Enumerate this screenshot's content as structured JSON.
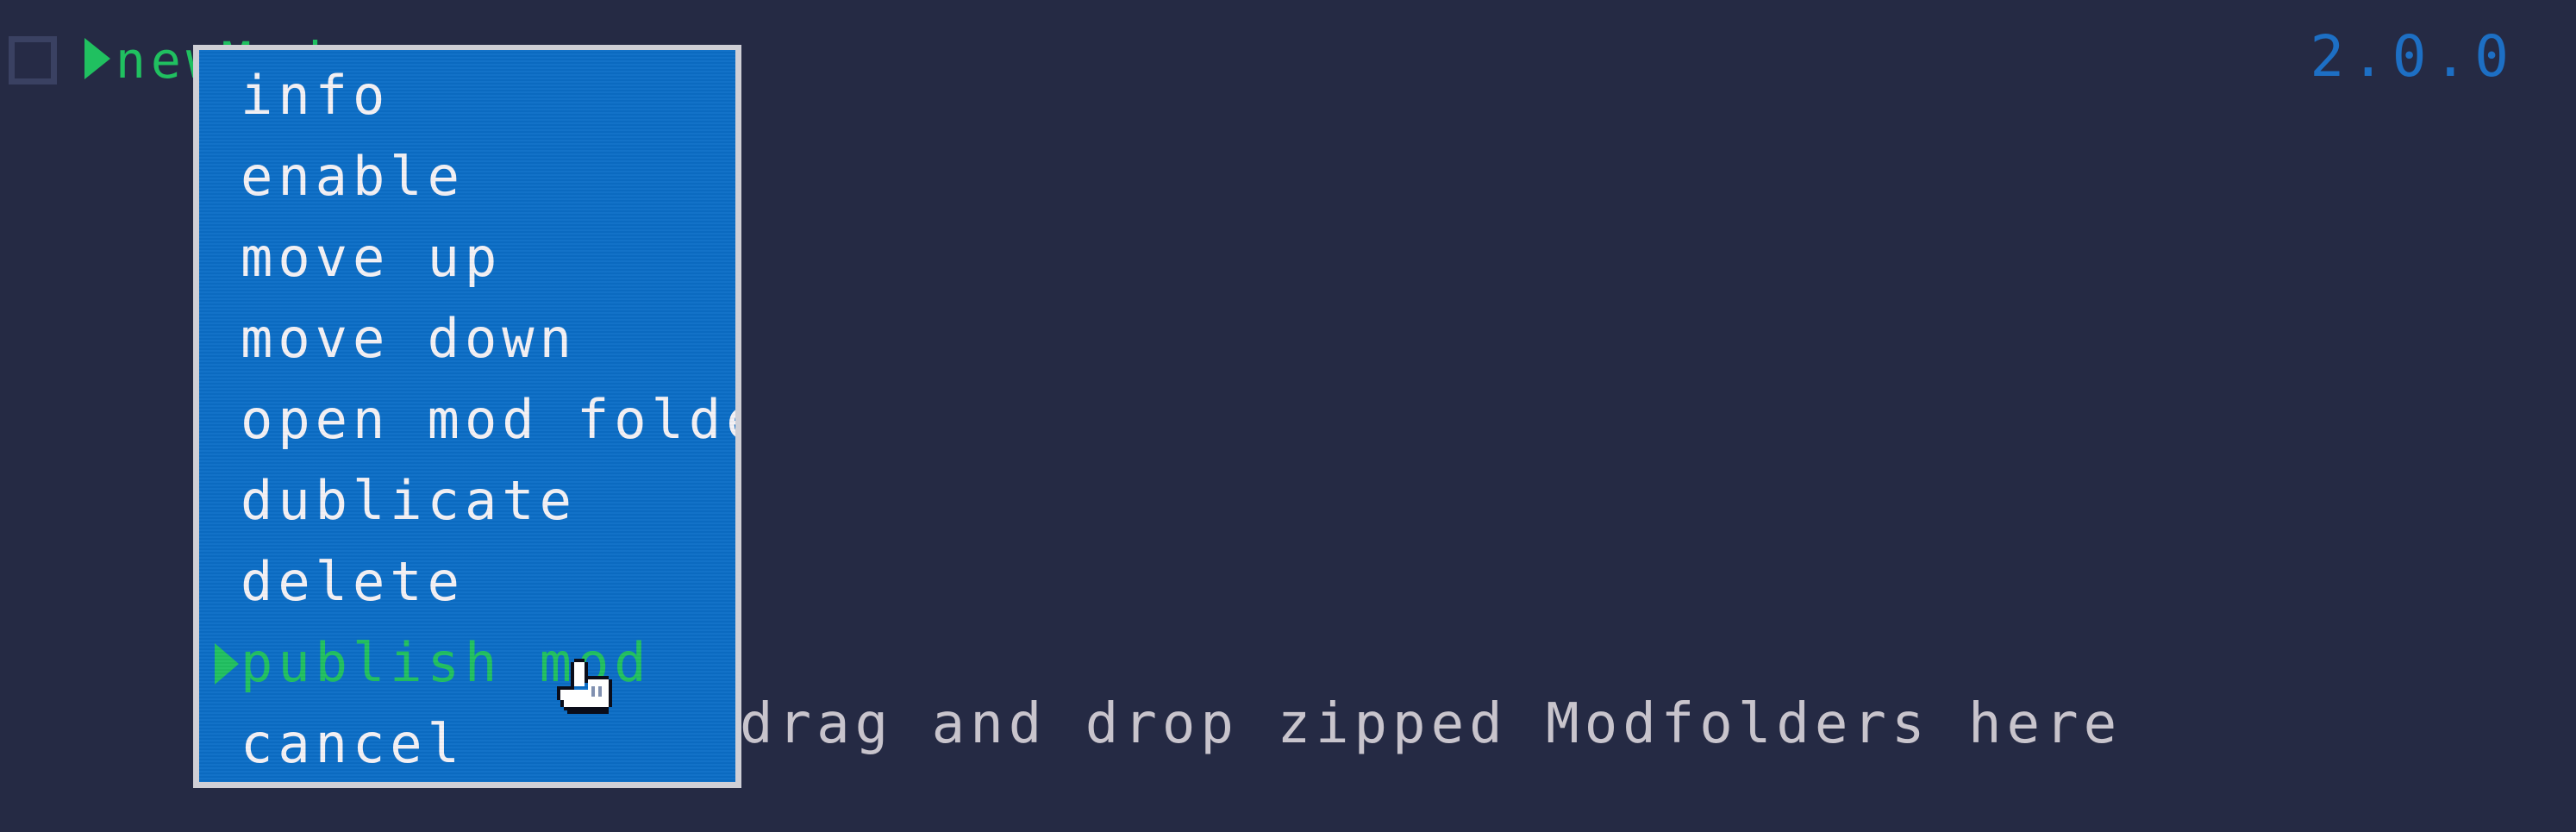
{
  "mod_row": {
    "name": "newMod",
    "checked": false
  },
  "version": "2.0.0",
  "hint": "drag and drop zipped Modfolders here",
  "context_menu": {
    "items": [
      {
        "label": "info"
      },
      {
        "label": "enable"
      },
      {
        "label": "move up"
      },
      {
        "label": "move down"
      },
      {
        "label": "open mod folder"
      },
      {
        "label": "dublicate"
      },
      {
        "label": "delete"
      },
      {
        "label": "publish mod",
        "selected": true
      },
      {
        "label": "cancel"
      }
    ]
  },
  "colors": {
    "background": "#252a44",
    "menu_bg": "#0b6dc6",
    "menu_border": "#cfcfd6",
    "selected": "#20c060",
    "version": "#1d6fc4",
    "hint_text": "#c8c4cc"
  },
  "icons": {
    "pointer": "triangle-right-icon",
    "cursor": "hand-pointer-icon"
  }
}
